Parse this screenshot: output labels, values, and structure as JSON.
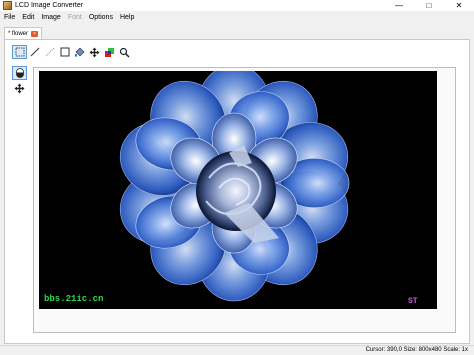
{
  "window": {
    "title": "LCD Image Converter",
    "icon": "app-icon",
    "controls": {
      "minimize": "—",
      "maximize": "□",
      "close": "✕"
    }
  },
  "menu": {
    "file": "File",
    "edit": "Edit",
    "image": "Image",
    "font": "Font",
    "options": "Options",
    "help": "Help"
  },
  "tab": {
    "label": "* flower",
    "close_icon": "close-icon"
  },
  "toolbar": {
    "tools": [
      "select-rect-icon",
      "line-icon",
      "pen-icon",
      "rectangle-icon",
      "fill-icon",
      "move-icon",
      "color-icon",
      "zoom-icon"
    ]
  },
  "sidetools": [
    "mouse-icon",
    "pan-icon"
  ],
  "canvas": {
    "watermark_left": "bbs.21ic.cn",
    "watermark_right": "ST"
  },
  "status": {
    "left": "",
    "cursor": "Cursor: 390,0",
    "size": "Size: 800x480",
    "scale": "Scale: 1x"
  },
  "colors": {
    "accent": "#5a9ad8",
    "watermark_green": "#2fd64a",
    "watermark_purple": "#c060d0",
    "tab_close": "#e05a2c"
  }
}
